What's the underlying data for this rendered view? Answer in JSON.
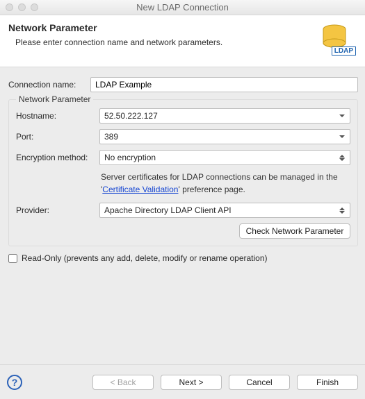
{
  "window": {
    "title": "New LDAP Connection"
  },
  "header": {
    "title": "Network Parameter",
    "subtitle": "Please enter connection name and network parameters.",
    "badge_label": "LDAP"
  },
  "connection": {
    "label": "Connection name:",
    "value": "LDAP Example"
  },
  "group": {
    "title": "Network Parameter",
    "hostname_label": "Hostname:",
    "hostname_value": "52.50.222.127",
    "port_label": "Port:",
    "port_value": "389",
    "encryption_label": "Encryption method:",
    "encryption_value": "No encryption",
    "cert_hint_pre": "Server certificates for LDAP connections can be managed in the '",
    "cert_link": "Certificate Validation",
    "cert_hint_post": "' preference page.",
    "provider_label": "Provider:",
    "provider_value": "Apache Directory LDAP Client API",
    "check_btn": "Check Network Parameter"
  },
  "readonly": {
    "label": "Read-Only (prevents any add, delete, modify or rename operation)",
    "checked": false
  },
  "footer": {
    "help_aria": "Help",
    "back": "< Back",
    "next": "Next >",
    "cancel": "Cancel",
    "finish": "Finish"
  }
}
